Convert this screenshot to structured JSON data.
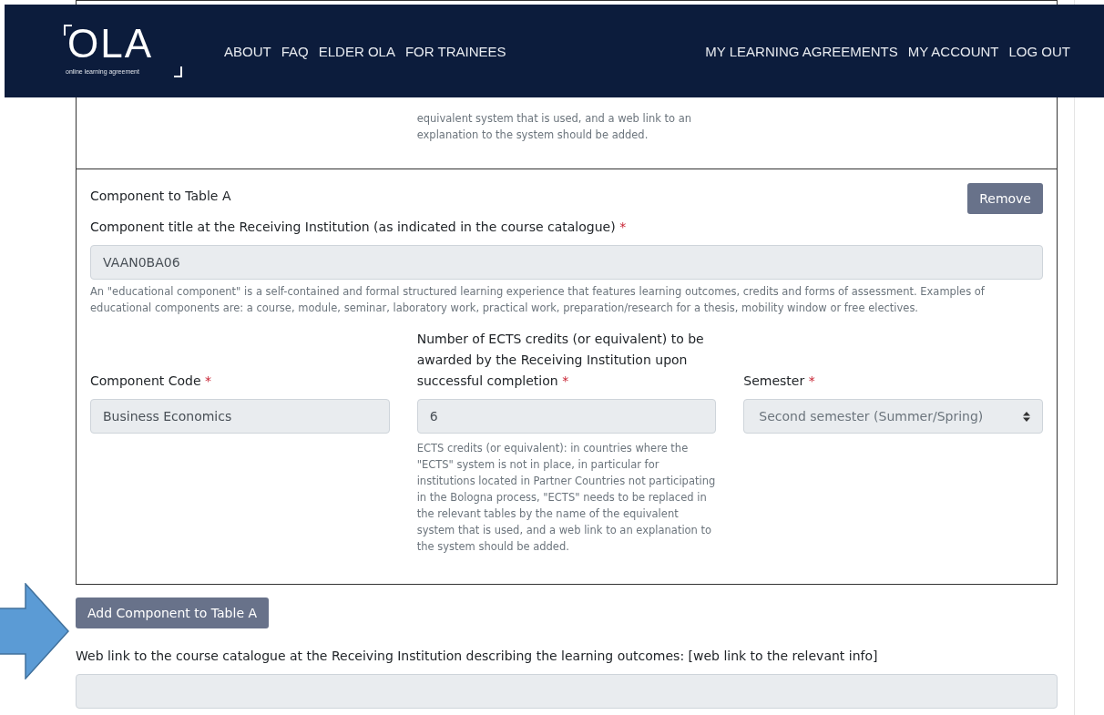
{
  "nav": {
    "logo": "OLA",
    "logo_tagline": "online learning agreement",
    "left_links": [
      "ABOUT",
      "FAQ",
      "ELDER OLA",
      "FOR TRAINEES"
    ],
    "right_links": [
      "MY LEARNING AGREEMENTS",
      "MY ACCOUNT",
      "LOG OUT"
    ]
  },
  "previous_component": {
    "help_text": "equivalent system that is used, and a web link to an explanation to the system should be added."
  },
  "component": {
    "heading": "Component to Table A",
    "remove_button": "Remove",
    "title_field": {
      "label": "Component title at the Receiving Institution (as indicated in the course catalogue)",
      "required_mark": "*",
      "value": "VAAN0BA06",
      "help_text": "An \"educational component\" is a self-contained and formal structured learning experience that features learning outcomes, credits and forms of assessment. Examples of educational components are: a course, module, seminar, laboratory work, practical work, preparation/research for a thesis, mobility window or free electives."
    },
    "fields": [
      {
        "kind": "input",
        "label": "Component Code",
        "required_mark": "*",
        "value": "Business Economics"
      },
      {
        "kind": "input",
        "label": "Number of ECTS credits (or equivalent) to be awarded by the Receiving Institution upon successful completion",
        "required_mark": "*",
        "value": "6",
        "help_text": "ECTS credits (or equivalent): in countries where the \"ECTS\" system is not in place, in particular for institutions located in Partner Countries not participating in the Bologna process, \"ECTS\" needs to be replaced in the relevant tables by the name of the equivalent system that is used, and a web link to an explanation to the system should be added."
      },
      {
        "kind": "select",
        "label": "Semester",
        "required_mark": "*",
        "value": "Second semester (Summer/Spring)"
      }
    ]
  },
  "add_button": "Add Component to Table A",
  "web_link_field": {
    "label": "Web link to the course catalogue at the Receiving Institution describing the learning outcomes: [web link to the relevant info]"
  }
}
